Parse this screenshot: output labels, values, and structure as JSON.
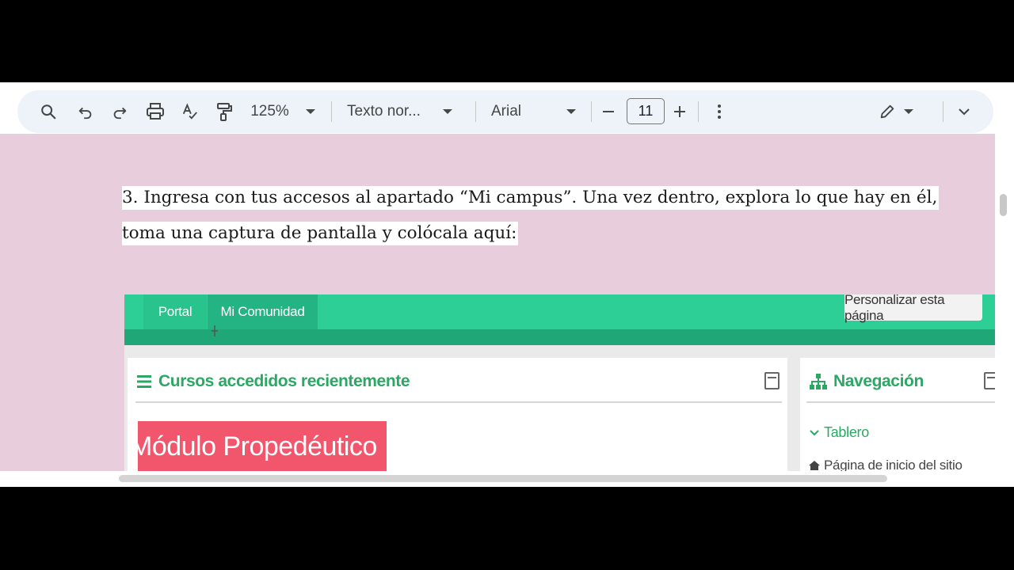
{
  "toolbar": {
    "zoom": "125%",
    "style": "Texto nor...",
    "font": "Arial",
    "font_size": "11",
    "icons": [
      "search-icon",
      "undo-icon",
      "redo-icon",
      "print-icon",
      "spellcheck-icon",
      "paint-format-icon",
      "minus-icon",
      "plus-icon",
      "more-vert-icon",
      "edit-pencil-icon",
      "chevron-down-icon"
    ]
  },
  "document": {
    "line1": "3. Ingresa con tus accesos al apartado “Mi campus”. Una vez dentro, explora lo que hay en él,",
    "line2": "toma una captura de pantalla y colócala aquí:"
  },
  "screenshot": {
    "tabs": [
      "Portal",
      "Mi Comunidad"
    ],
    "customize_label": "Personalizar esta página",
    "recent_courses_title": "Cursos accedidos recientemente",
    "course_banner": "Módulo Propedéutico",
    "navigation_title": "Navegación",
    "nav_items": [
      "Tablero",
      "Página de inicio del sitio"
    ],
    "colors": {
      "nav_green": "#2ecf97",
      "title_green": "#2aa864",
      "banner_red": "#f2566c"
    }
  },
  "colors": {
    "doc_background": "#e8cedc",
    "toolbar": "#eef2f9"
  }
}
